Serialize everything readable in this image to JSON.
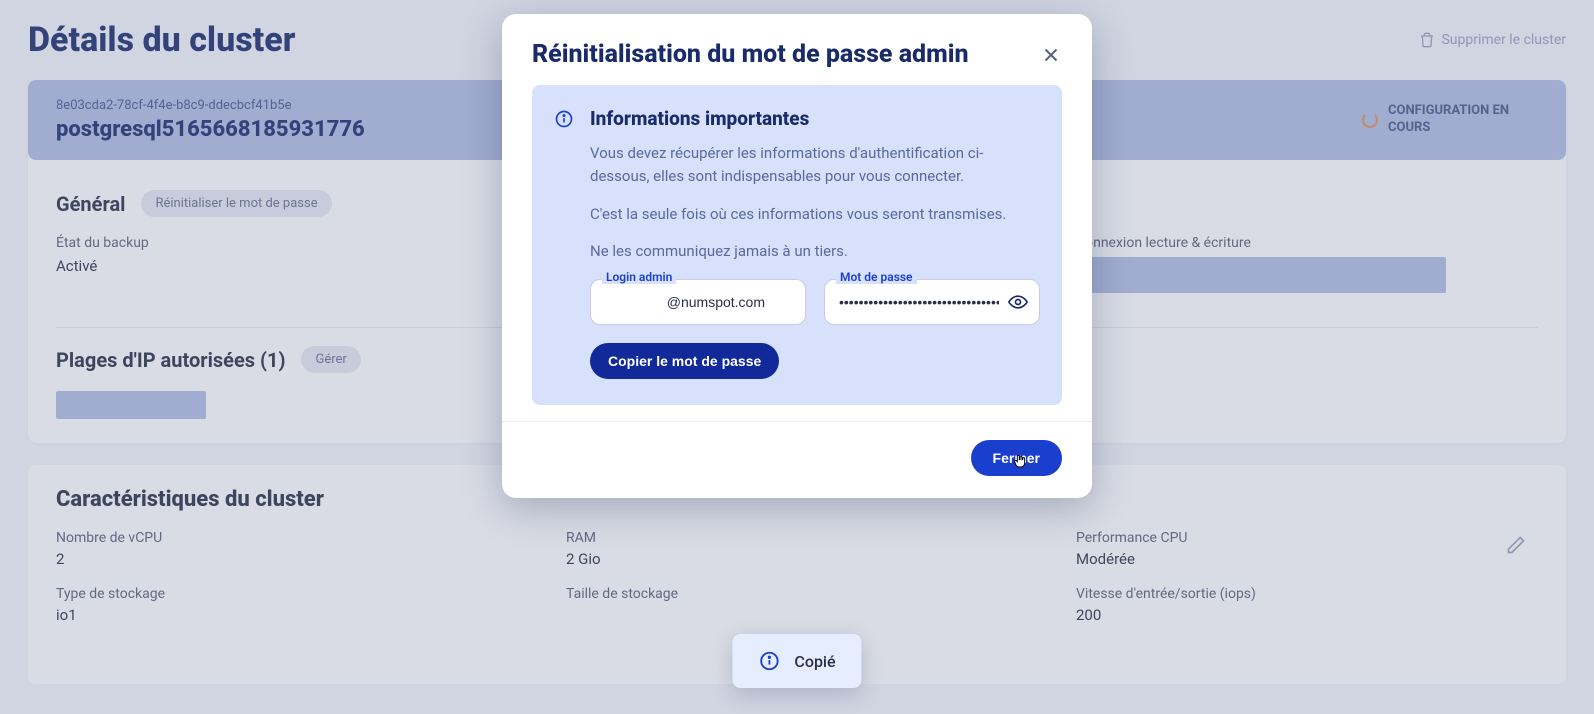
{
  "header": {
    "title": "Détails du cluster",
    "delete_label": "Supprimer le cluster"
  },
  "cluster": {
    "uuid": "8e03cda2-78cf-4f4e-b8c9-ddecbcf41b5e",
    "name": "postgresql5165668185931776",
    "status": "CONFIGURATION EN COURS"
  },
  "general": {
    "title": "Général",
    "reset_pill": "Réinitialiser le mot de passe",
    "backup_state_label": "État du backup",
    "backup_state_value": "Activé",
    "conn_rw_label": "Connexion lecture & écriture"
  },
  "ip": {
    "title": "Plages d'IP autorisées (1)",
    "pill": "Gérer"
  },
  "chars": {
    "title": "Caractéristiques du cluster",
    "vcpu_label": "Nombre de vCPU",
    "vcpu_value": "2",
    "ram_label": "RAM",
    "ram_value": "2 Gio",
    "perf_label": "Performance CPU",
    "perf_value": "Modérée",
    "storage_type_label": "Type de stockage",
    "storage_type_value": "io1",
    "storage_size_label": "Taille de stockage",
    "iops_label": "Vitesse d'entrée/sortie (iops)",
    "iops_value": "200"
  },
  "modal": {
    "title": "Réinitialisation du mot de passe admin",
    "info_title": "Informations importantes",
    "p1": "Vous devez récupérer les informations d'authentification ci-dessous, elles sont indispensables pour vous connecter.",
    "p2": "C'est la seule fois où ces informations vous seront transmises.",
    "p3": "Ne les communiquez jamais à un tiers.",
    "login_label": "Login admin",
    "login_value": "@numspot.com",
    "password_label": "Mot de passe",
    "password_value": "••••••••••••••••••••••••••••••••••••••",
    "copy_label": "Copier le mot de passe",
    "close_label": "Fermer"
  },
  "toast": {
    "text": "Copié"
  }
}
